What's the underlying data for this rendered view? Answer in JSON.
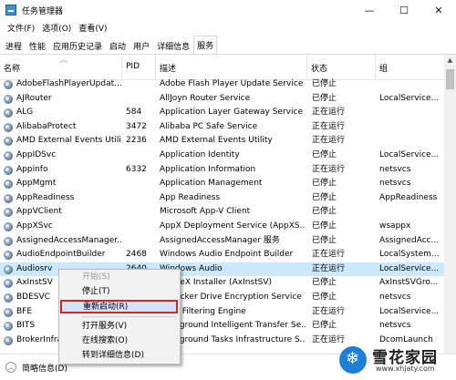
{
  "window": {
    "title": "任务管理器",
    "minimize": "—",
    "maximize": "☐",
    "close": "✕"
  },
  "menu": [
    "文件(F)",
    "选项(O)",
    "查看(V)"
  ],
  "tabs": [
    "进程",
    "性能",
    "应用历史记录",
    "启动",
    "用户",
    "详细信息",
    "服务"
  ],
  "active_tab": "服务",
  "columns": {
    "name": "名称",
    "pid": "PID",
    "desc": "描述",
    "status": "状态",
    "group": "组"
  },
  "rows": [
    {
      "name": "AdobeFlashPlayerUpdat...",
      "pid": "",
      "desc": "Adobe Flash Player Update Service",
      "status": "已停止",
      "group": ""
    },
    {
      "name": "AJRouter",
      "pid": "",
      "desc": "AllJoyn Router Service",
      "status": "已停止",
      "group": "LocalService..."
    },
    {
      "name": "ALG",
      "pid": "584",
      "desc": "Application Layer Gateway Service",
      "status": "正在运行",
      "group": ""
    },
    {
      "name": "AlibabaProtect",
      "pid": "3472",
      "desc": "Alibaba PC Safe Service",
      "status": "正在运行",
      "group": ""
    },
    {
      "name": "AMD External Events Utili...",
      "pid": "2236",
      "desc": "AMD External Events Utility",
      "status": "正在运行",
      "group": ""
    },
    {
      "name": "AppIDSvc",
      "pid": "",
      "desc": "Application Identity",
      "status": "已停止",
      "group": "LocalService..."
    },
    {
      "name": "Appinfo",
      "pid": "6332",
      "desc": "Application Information",
      "status": "正在运行",
      "group": "netsvcs"
    },
    {
      "name": "AppMgmt",
      "pid": "",
      "desc": "Application Management",
      "status": "已停止",
      "group": "netsvcs"
    },
    {
      "name": "AppReadiness",
      "pid": "",
      "desc": "App Readiness",
      "status": "已停止",
      "group": "AppReadiness"
    },
    {
      "name": "AppVClient",
      "pid": "",
      "desc": "Microsoft App-V Client",
      "status": "已停止",
      "group": ""
    },
    {
      "name": "AppXSvc",
      "pid": "",
      "desc": "AppX Deployment Service (AppXS...",
      "status": "已停止",
      "group": "wsappx"
    },
    {
      "name": "AssignedAccessManager...",
      "pid": "",
      "desc": "AssignedAccessManager 服务",
      "status": "已停止",
      "group": "AssignedAcc..."
    },
    {
      "name": "AudioEndpointBuilder",
      "pid": "2468",
      "desc": "Windows Audio Endpoint Builder",
      "status": "正在运行",
      "group": "LocalSystem..."
    },
    {
      "name": "Audiosrv",
      "pid": "2640",
      "desc": "Windows Audio",
      "status": "正在运行",
      "group": "LocalService..."
    },
    {
      "name": "AxInstSV",
      "pid": "",
      "desc": "ActiveX Installer (AxInstSV)",
      "status": "已停止",
      "group": "AxInstSVGro..."
    },
    {
      "name": "BDESVC",
      "pid": "",
      "desc": "BitLocker Drive Encryption Service",
      "status": "已停止",
      "group": "netsvcs"
    },
    {
      "name": "BFE",
      "pid": "",
      "desc": "Base Filtering Engine",
      "status": "正在运行",
      "group": "LocalService..."
    },
    {
      "name": "BITS",
      "pid": "",
      "desc": "Background Intelligent Transfer Se...",
      "status": "已停止",
      "group": "netsvcs"
    },
    {
      "name": "BrokerInfrastructure",
      "pid": "",
      "desc": "Background Tasks Infrastructure S...",
      "status": "正在运行",
      "group": "DcomLaunch"
    }
  ],
  "context_menu": [
    "开始(S)",
    "停止(T)",
    "重新启动(R)",
    "打开服务(V)",
    "在线搜索(O)",
    "转到详细信息(D)"
  ],
  "footer": {
    "label": "简略信息(D)"
  },
  "watermark": {
    "title": "雪花家园",
    "url": "www.xhjaty.com"
  }
}
